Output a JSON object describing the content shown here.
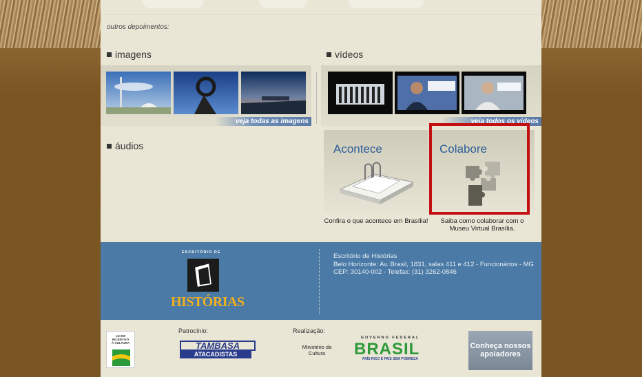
{
  "top": {
    "outros_label": "outros depoimentos:"
  },
  "sections": {
    "imagens": {
      "title": "imagens",
      "more_link": "veja todas as imagens"
    },
    "videos": {
      "title": "vídeos",
      "more_link": "veja todos os vídeos"
    },
    "audios": {
      "title": "áudios"
    }
  },
  "cards": {
    "acontece": {
      "title": "Acontece",
      "desc": "Confira o que acontece em Brasília!"
    },
    "colabore": {
      "title": "Colabore",
      "desc": "Saiba como colaborar com o Museu Virtual Brasília."
    }
  },
  "footer": {
    "logo_top": "ESCRITÓRIO DE",
    "logo_main": "HISTÓRIAS",
    "org_name": "Escritório de Histórias",
    "address": "Belo Horizonte: Av. Brasil, 1831, salas 411 e 412 - Funcionários - MG CEP: 30140-002 - Telefax: (31) 3262-0846"
  },
  "sponsors": {
    "lei_logo": "LEI DE INCENTIVO À CULTURA",
    "patrocinio_label": "Patrocínio:",
    "tambasa_top": "TAMBASA",
    "tambasa_bottom": "ATACADISTAS",
    "realizacao_label": "Realização:",
    "minc": "Ministério da Cultura",
    "gov_top": "GOVERNO FEDERAL",
    "brasil": "BRASIL",
    "gov_bottom": "PAÍS RICO É PAÍS SEM POBREZA",
    "conheca": "Conheça nossos apoiadores"
  },
  "colors": {
    "highlight": "#c40f12",
    "footer_blue": "#4a7aa5",
    "card_title": "#2e5f9a"
  }
}
